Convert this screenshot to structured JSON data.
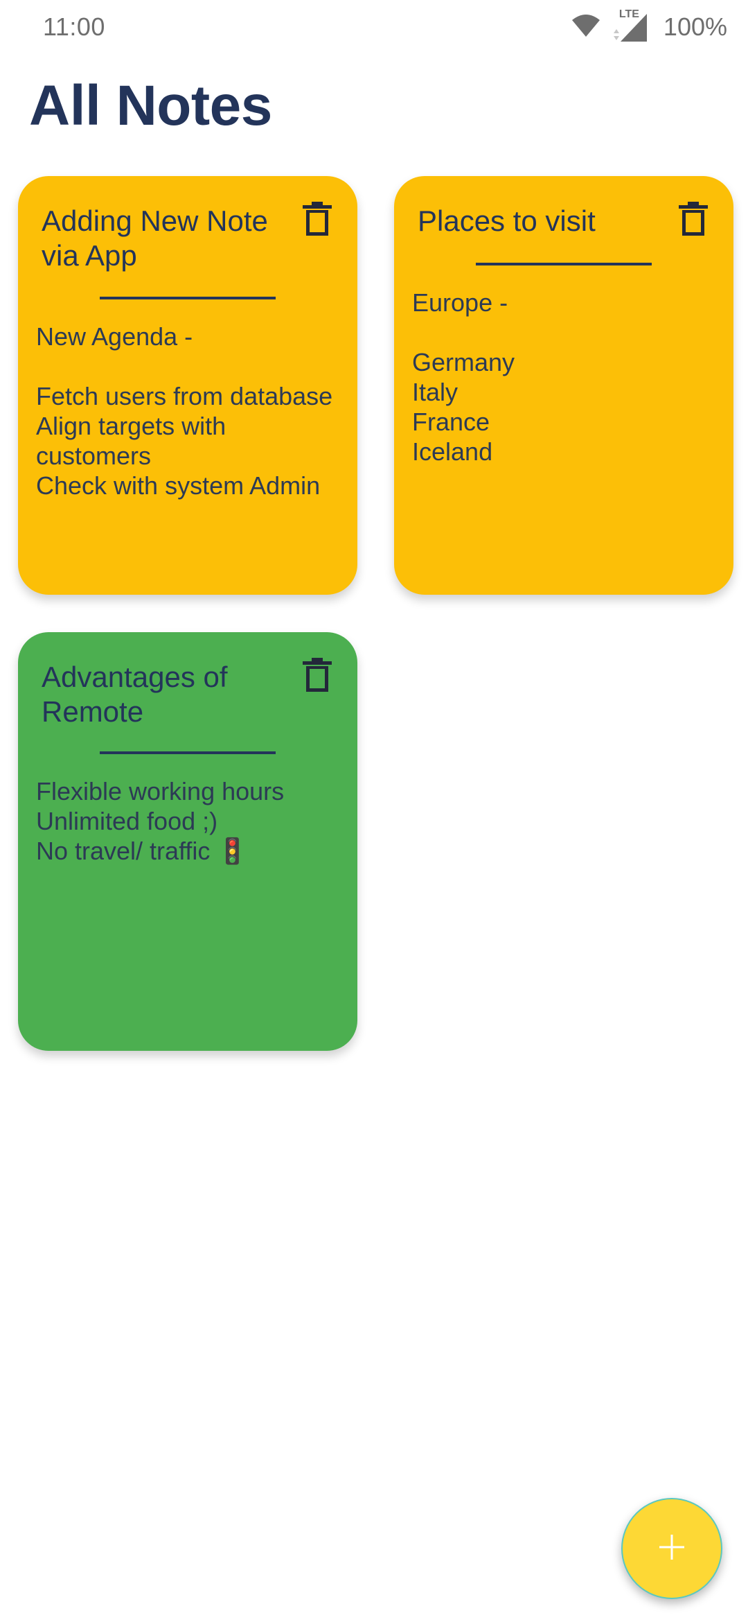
{
  "status_bar": {
    "time": "11:00",
    "network": "LTE",
    "battery": "100%",
    "icons": [
      "wifi-icon",
      "cell-signal-icon"
    ]
  },
  "page": {
    "title": "All Notes"
  },
  "notes": [
    {
      "title": "Adding New Note via App",
      "body": "New Agenda -\n\nFetch users from database\nAlign targets with customers\nCheck with system Admin",
      "color": "#fcbf07",
      "delete_icon": "trash-icon"
    },
    {
      "title": "Places to visit",
      "body": "Europe -\n\nGermany\nItaly\nFrance\nIceland",
      "color": "#fcbf07",
      "delete_icon": "trash-icon"
    },
    {
      "title": "Advantages of Remote",
      "body": "Flexible working hours\nUnlimited food ;)\nNo travel/ traffic 🚦",
      "color": "#4caf50",
      "delete_icon": "trash-icon"
    }
  ],
  "fab": {
    "icon": "plus-icon",
    "color": "#fdd835"
  }
}
